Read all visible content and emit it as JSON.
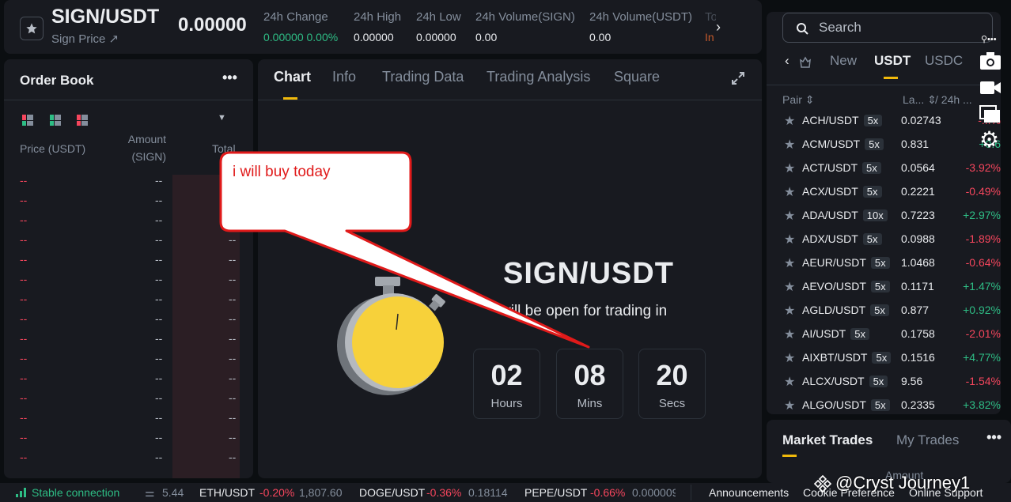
{
  "header": {
    "pair": "SIGN/USDT",
    "sign_price": "Sign Price ↗",
    "last_price": "0.00000",
    "stats": [
      {
        "label": "24h Change",
        "value": "0.00000 0.00%",
        "color": "#2ebd85"
      },
      {
        "label": "24h High",
        "value": "0.00000"
      },
      {
        "label": "24h Low",
        "value": "0.00000"
      },
      {
        "label": "24h Volume(SIGN)",
        "value": "0.00"
      },
      {
        "label": "24h Volume(USDT)",
        "value": "0.00"
      },
      {
        "label": "To",
        "value": "In",
        "color": "#c0582b"
      }
    ]
  },
  "orderbook": {
    "title": "Order Book",
    "more": "•••",
    "col_price": "Price (USDT)",
    "col_amount_line1": "Amount",
    "col_amount_line2": "(SIGN)",
    "col_total": "Total",
    "placeholder": "--"
  },
  "center": {
    "tabs": [
      "Chart",
      "Info",
      "Trading Data",
      "Trading Analysis",
      "Square"
    ],
    "active_tab": 0,
    "pair_big": "SIGN/USDT",
    "open_text": "will be open for trading in",
    "countdown": [
      {
        "num": "02",
        "unit": "Hours"
      },
      {
        "num": "08",
        "unit": "Mins"
      },
      {
        "num": "20",
        "unit": "Secs"
      }
    ]
  },
  "callout": {
    "text": "i will buy today"
  },
  "market": {
    "search_placeholder": "Search",
    "tabs": [
      "New",
      "USDT",
      "USDC"
    ],
    "active_tab": 1,
    "head_pair": "Pair",
    "head_last": "La...",
    "head_24h": "/ 24h ...",
    "rows": [
      {
        "sym": "ACH/USDT",
        "lev": "5x",
        "price": "0.02743",
        "chg": "-...%",
        "up": false
      },
      {
        "sym": "ACM/USDT",
        "lev": "5x",
        "price": "0.831",
        "chg": "+0.6",
        "up": true
      },
      {
        "sym": "ACT/USDT",
        "lev": "5x",
        "price": "0.0564",
        "chg": "-3.92%",
        "up": false
      },
      {
        "sym": "ACX/USDT",
        "lev": "5x",
        "price": "0.2221",
        "chg": "-0.49%",
        "up": false
      },
      {
        "sym": "ADA/USDT",
        "lev": "10x",
        "price": "0.7223",
        "chg": "+2.97%",
        "up": true
      },
      {
        "sym": "ADX/USDT",
        "lev": "5x",
        "price": "0.0988",
        "chg": "-1.89%",
        "up": false
      },
      {
        "sym": "AEUR/USDT",
        "lev": "5x",
        "price": "1.0468",
        "chg": "-0.64%",
        "up": false
      },
      {
        "sym": "AEVO/USDT",
        "lev": "5x",
        "price": "0.1171",
        "chg": "+1.47%",
        "up": true
      },
      {
        "sym": "AGLD/USDT",
        "lev": "5x",
        "price": "0.877",
        "chg": "+0.92%",
        "up": true
      },
      {
        "sym": "AI/USDT",
        "lev": "5x",
        "price": "0.1758",
        "chg": "-2.01%",
        "up": false
      },
      {
        "sym": "AIXBT/USDT",
        "lev": "5x",
        "price": "0.1516",
        "chg": "+4.77%",
        "up": true
      },
      {
        "sym": "ALCX/USDT",
        "lev": "5x",
        "price": "9.56",
        "chg": "-1.54%",
        "up": false
      },
      {
        "sym": "ALGO/USDT",
        "lev": "5x",
        "price": "0.2335",
        "chg": "+3.82%",
        "up": true
      }
    ]
  },
  "trades": {
    "tab_market": "Market Trades",
    "tab_my": "My Trades",
    "more": "•••",
    "amount": "Amount"
  },
  "footer": {
    "connection": "Stable connection",
    "ticker0": "5.44",
    "tickers": [
      {
        "pair": "ETH/USDT",
        "chg": "-0.20%",
        "price": "1,807.60"
      },
      {
        "pair": "DOGE/USDT",
        "chg": "-0.36%",
        "price": "0.18114"
      },
      {
        "pair": "PEPE/USDT",
        "chg": "-0.66%",
        "price": "0.000009"
      }
    ],
    "announcements": "Announcements",
    "cookie": "Cookie Preference",
    "support": "Online Support"
  },
  "watermark": "@Cryst   Journey1",
  "colors": {
    "accent": "#f0b90b",
    "up": "#2ebd85",
    "down": "#f6465d",
    "callout": "#e01a1a"
  }
}
